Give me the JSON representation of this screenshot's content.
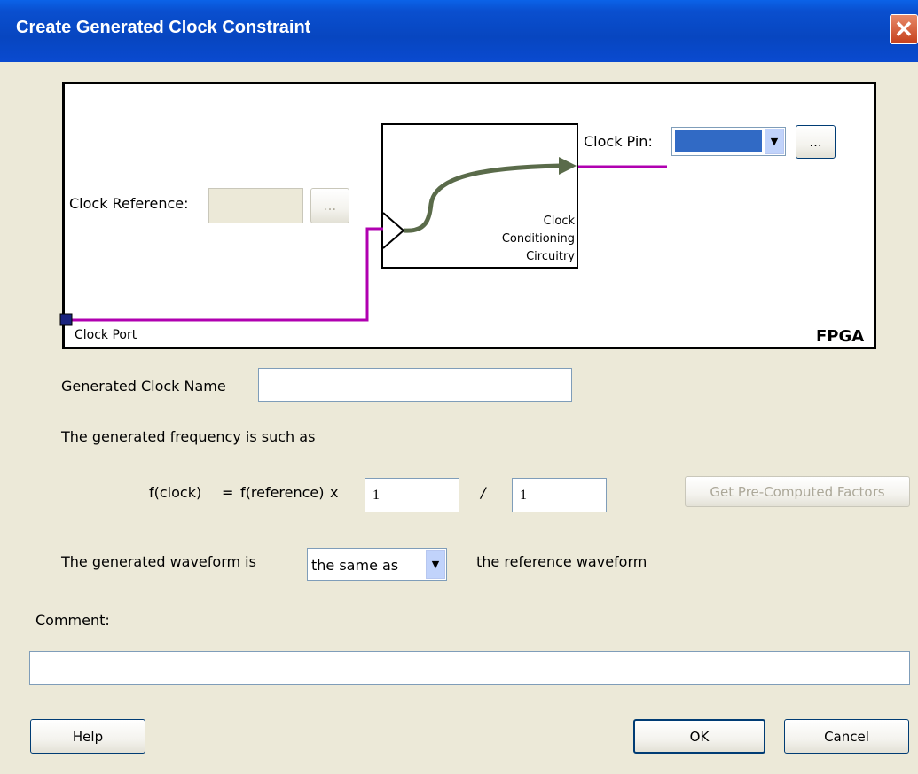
{
  "window": {
    "title": "Create Generated Clock Constraint",
    "close_glyph": "✕"
  },
  "diagram": {
    "clock_reference_label": "Clock Reference:",
    "clock_reference_value": "",
    "clock_reference_browse": "...",
    "clock_pin_label": "Clock Pin:",
    "clock_pin_value": "",
    "clock_pin_browse": "...",
    "conditioning_line1": "Clock",
    "conditioning_line2": "Conditioning",
    "conditioning_line3": "Circuitry",
    "clock_port_label": "Clock Port",
    "fpga_label": "FPGA",
    "colors": {
      "wire": "#b000b0",
      "signal_arrow": "#5a6b4a",
      "port_square": "#1a237e"
    }
  },
  "form": {
    "generated_clock_name_label": "Generated Clock Name",
    "generated_clock_name_value": "",
    "frequency_sentence": "The generated frequency is such as",
    "formula_left": "f(clock)",
    "formula_equals": "=",
    "formula_reference": "f(reference)",
    "formula_times": "x",
    "multiplier_value": "1",
    "formula_divide": "/",
    "divider_value": "1",
    "get_factors_button": "Get Pre-Computed Factors",
    "waveform_prefix": "The generated waveform is",
    "waveform_option": "the same as",
    "waveform_suffix": "the reference waveform",
    "comment_label": "Comment:",
    "comment_value": ""
  },
  "footer": {
    "help": "Help",
    "ok": "OK",
    "cancel": "Cancel"
  }
}
